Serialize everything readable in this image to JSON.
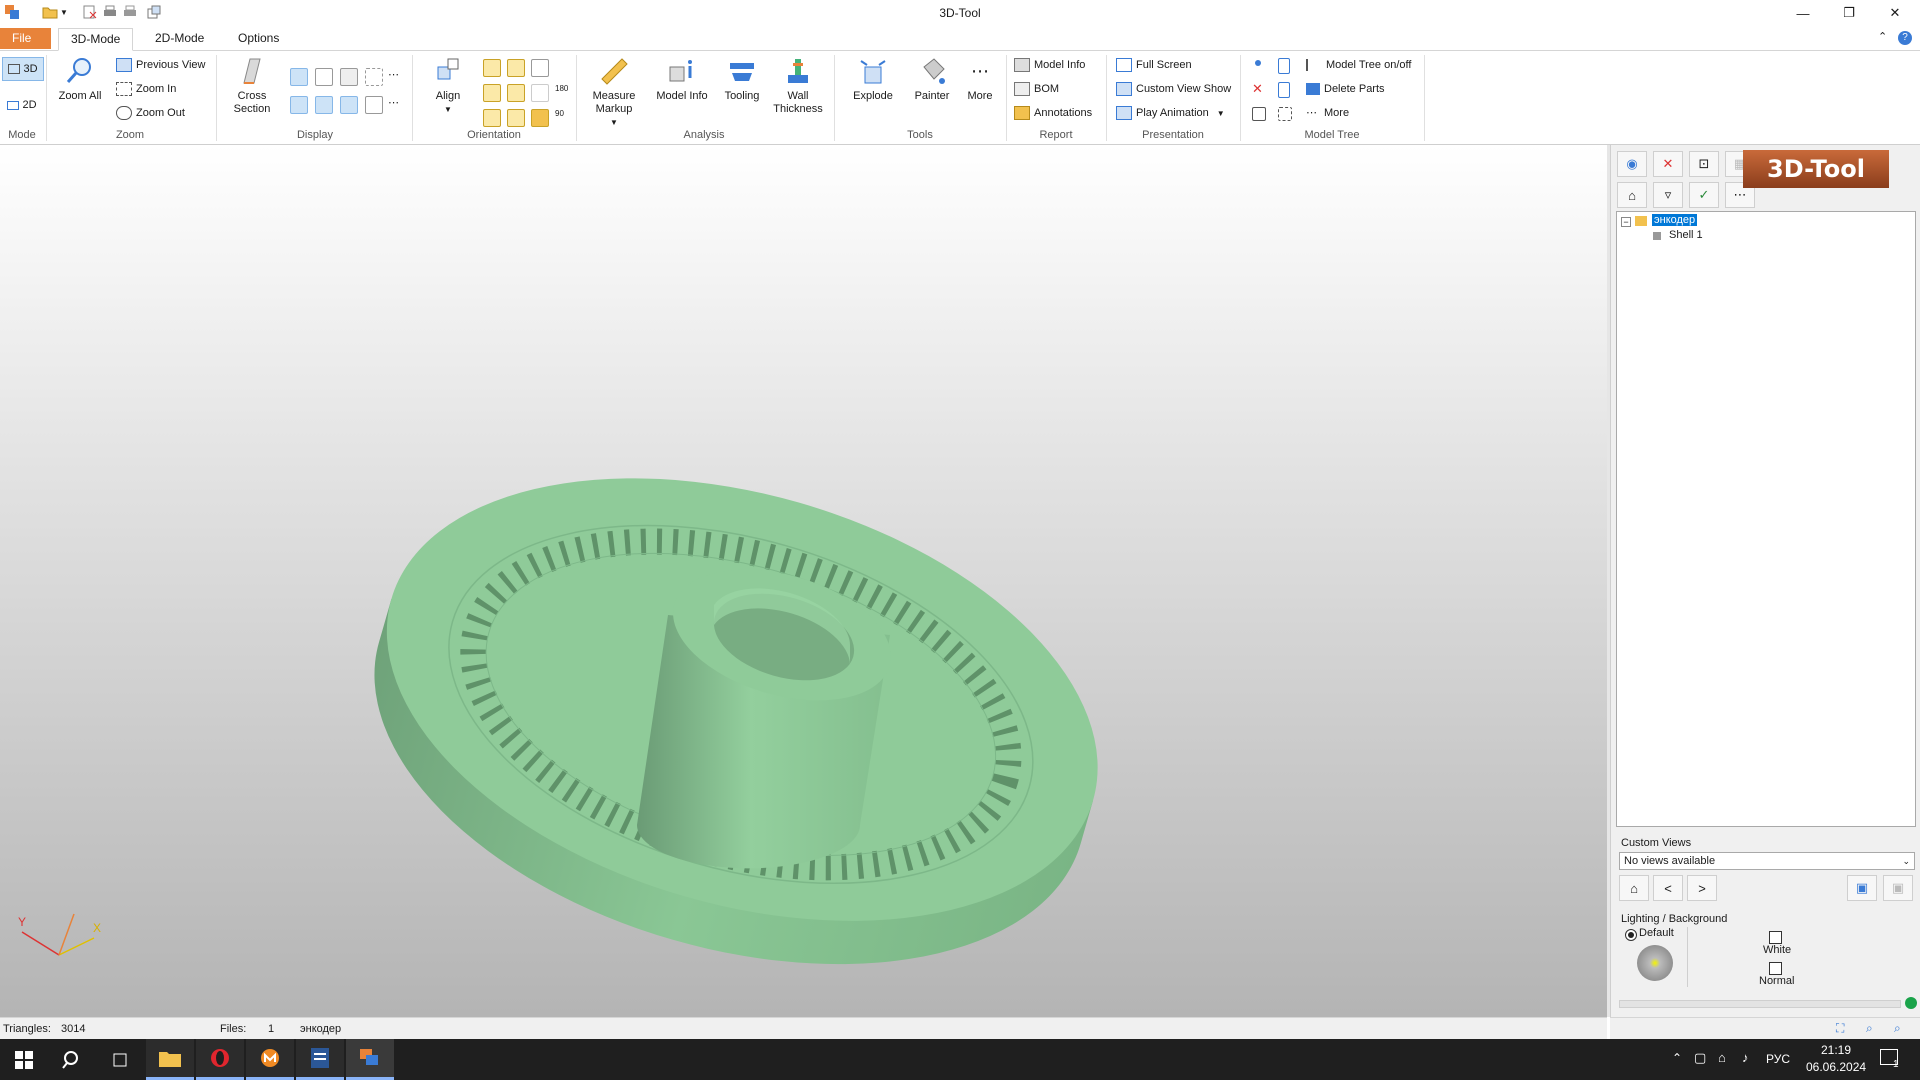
{
  "window": {
    "title": "3D-Tool"
  },
  "tabs": {
    "file": "File",
    "mode3d": "3D-Mode",
    "mode2d": "2D-Mode",
    "options": "Options"
  },
  "ribbon": {
    "mode": {
      "btn3d": "3D",
      "btn2d": "2D",
      "label": "Mode"
    },
    "zoom": {
      "zoom_all": "Zoom All",
      "previous_view": "Previous View",
      "zoom_in": "Zoom In",
      "zoom_out": "Zoom Out",
      "label": "Zoom"
    },
    "display": {
      "cross_section_1": "Cross",
      "cross_section_2": "Section",
      "label": "Display"
    },
    "orientation": {
      "align": "Align",
      "label": "Orientation"
    },
    "analysis": {
      "measure_1": "Measure",
      "measure_2": "Markup",
      "model_info": "Model Info",
      "tooling": "Tooling",
      "wall_1": "Wall",
      "wall_2": "Thickness",
      "label": "Analysis"
    },
    "tools": {
      "explode": "Explode",
      "painter": "Painter",
      "more": "More",
      "label": "Tools"
    },
    "report": {
      "model_info": "Model Info",
      "bom": "BOM",
      "annotations": "Annotations",
      "label": "Report"
    },
    "presentation": {
      "full_screen": "Full Screen",
      "custom_view_show": "Custom View Show",
      "play_animation": "Play Animation",
      "label": "Presentation"
    },
    "model_tree": {
      "toggle": "Model Tree on/off",
      "delete_parts": "Delete Parts",
      "more": "More",
      "label": "Model Tree"
    }
  },
  "panel": {
    "logo": "3D-Tool",
    "tree": {
      "root": "энкодер",
      "child": "Shell 1"
    },
    "custom_views": {
      "label": "Custom Views",
      "select_value": "No views available",
      "prev": "<",
      "next": ">"
    },
    "lighting": {
      "label": "Lighting / Background",
      "default": "Default",
      "white": "White",
      "normal": "Normal"
    }
  },
  "status": {
    "triangles_label": "Triangles:",
    "triangles_value": "3014",
    "files_label": "Files:",
    "files_value": "1",
    "file_name": "энкодер"
  },
  "axes": {
    "y": "Y",
    "x": "X"
  },
  "taskbar": {
    "lang": "РУС",
    "time": "21:19",
    "date": "06.06.2024",
    "notif": "1"
  },
  "colors": {
    "model": "#8fcb99",
    "accent_file_tab": "#e8833a",
    "selection": "#0078d7"
  }
}
